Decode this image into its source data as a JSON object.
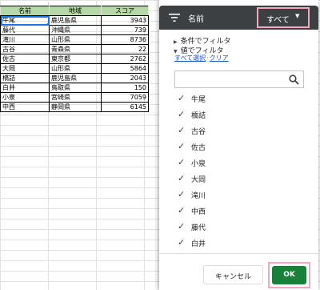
{
  "sheet": {
    "headers": [
      "名前",
      "地域",
      "スコア"
    ],
    "rows": [
      {
        "name": "牛尾",
        "region": "鹿児島県",
        "score": "3943"
      },
      {
        "name": "藤代",
        "region": "沖縄県",
        "score": "739"
      },
      {
        "name": "滝川",
        "region": "山形県",
        "score": "8736"
      },
      {
        "name": "古谷",
        "region": "青森県",
        "score": "22"
      },
      {
        "name": "佐古",
        "region": "東京都",
        "score": "2762"
      },
      {
        "name": "大岡",
        "region": "山形県",
        "score": "5864"
      },
      {
        "name": "橋詰",
        "region": "鹿児島県",
        "score": "2043"
      },
      {
        "name": "白井",
        "region": "鳥取県",
        "score": "150"
      },
      {
        "name": "小泉",
        "region": "宮崎県",
        "score": "7059"
      },
      {
        "name": "中西",
        "region": "静岡県",
        "score": "6145"
      }
    ]
  },
  "filter_panel": {
    "title": "名前",
    "all_button": "すべて",
    "filter_by_condition": "条件でフィルタ",
    "filter_by_values": "値でフィルタ",
    "select_all": "すべて選択",
    "clear": "クリア",
    "search_placeholder": "",
    "items": [
      {
        "label": "牛尾",
        "checked": true
      },
      {
        "label": "橋詰",
        "checked": true
      },
      {
        "label": "古谷",
        "checked": true
      },
      {
        "label": "佐古",
        "checked": true
      },
      {
        "label": "小泉",
        "checked": true
      },
      {
        "label": "大岡",
        "checked": true
      },
      {
        "label": "滝川",
        "checked": true
      },
      {
        "label": "中西",
        "checked": true
      },
      {
        "label": "藤代",
        "checked": true
      },
      {
        "label": "白井",
        "checked": true
      }
    ],
    "cancel": "キャンセル",
    "ok": "OK"
  },
  "colors": {
    "header_fill": "#b6d7a8",
    "panel_header": "#3c4043",
    "ok_button": "#188038",
    "highlight": "#f4a7bd",
    "selection": "#1a73e8"
  },
  "icons": {
    "filter": "filter-icon",
    "search": "search-icon",
    "check": "checkmark-icon"
  }
}
